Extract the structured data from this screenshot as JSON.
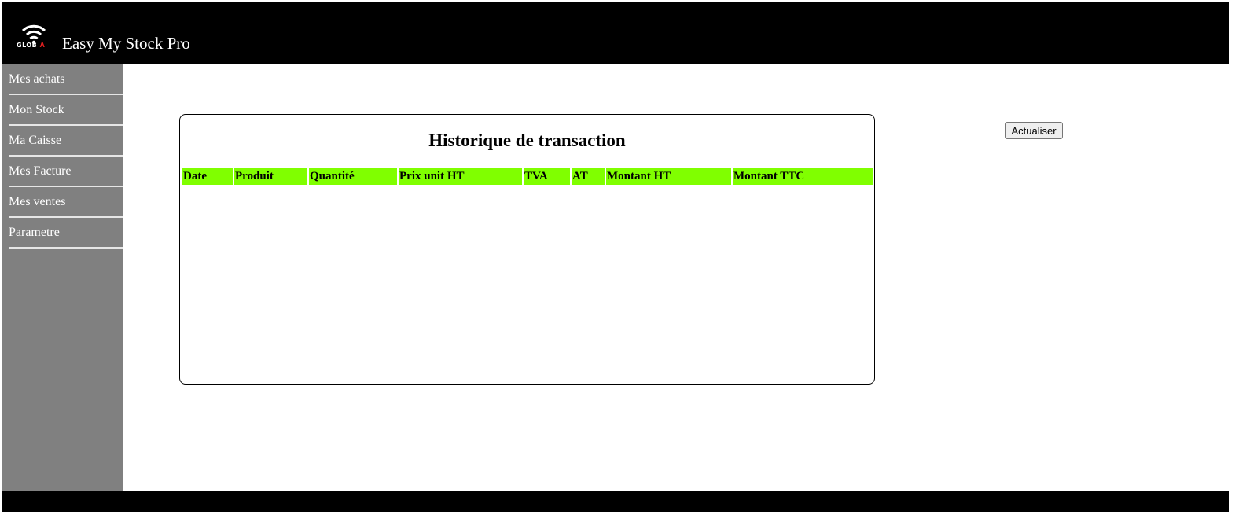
{
  "header": {
    "logo_text_main": "GLOB",
    "logo_text_accent": "A",
    "logo_icon": "wifi-icon",
    "title": "Easy My Stock Pro"
  },
  "sidebar": {
    "items": [
      {
        "label": "Mes achats"
      },
      {
        "label": "Mon Stock"
      },
      {
        "label": "Ma Caisse"
      },
      {
        "label": "Mes Facture"
      },
      {
        "label": "Mes ventes"
      },
      {
        "label": "Parametre"
      }
    ]
  },
  "main": {
    "panel_title": "Historique de transaction",
    "table": {
      "columns": [
        "Date",
        "Produit",
        "Quantité",
        "Prix unit HT",
        "TVA",
        "AT",
        "Montant HT",
        "Montant TTC"
      ],
      "rows": []
    },
    "refresh_label": "Actualiser"
  },
  "colors": {
    "header_bg": "#000000",
    "sidebar_bg": "#808080",
    "table_header_bg": "#80ff00",
    "logo_accent": "#e02020"
  }
}
